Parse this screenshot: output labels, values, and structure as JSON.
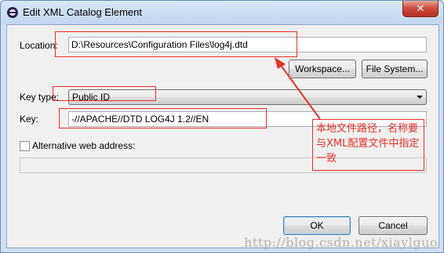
{
  "window": {
    "title": "Edit XML Catalog Element",
    "close_glyph": "✕",
    "app_icon": "eclipse-icon"
  },
  "form": {
    "location_label": "Location:",
    "location_value": "D:\\Resources\\Configuration Files\\log4j.dtd",
    "workspace_button": "Workspace...",
    "filesystem_button": "File System...",
    "keytype_label": "Key type:",
    "keytype_value": "Public ID",
    "key_label": "Key:",
    "key_value": "-//APACHE//DTD LOG4J 1.2//EN",
    "alt_web_label": "Alternative web address:",
    "alt_web_checked": false,
    "alt_web_value": ""
  },
  "footer": {
    "ok_button": "OK",
    "cancel_button": "Cancel"
  },
  "annotation": {
    "note": "本地文件路径，名称要与XML配置文件中指定一致",
    "color": "#e8302a"
  },
  "watermark": "http://blog.csdn.net/xiaylguo"
}
